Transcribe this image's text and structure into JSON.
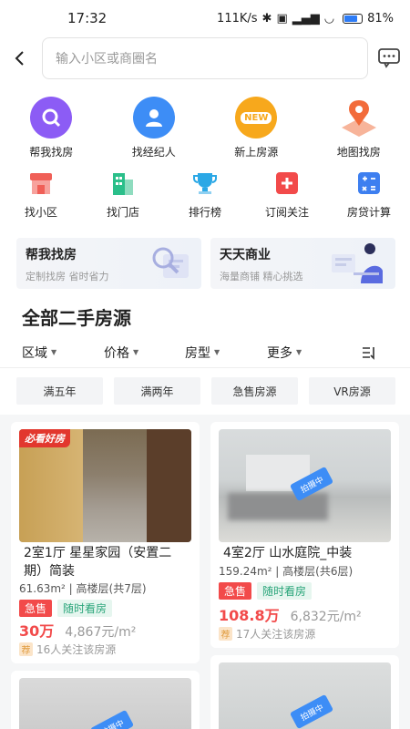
{
  "status_bar": {
    "time": "17:32",
    "speed": "111K/s",
    "battery": "81%"
  },
  "search": {
    "placeholder": "输入小区或商圈名"
  },
  "primary_nav": [
    {
      "label": "帮我找房",
      "icon": "magnifier-icon",
      "color": "#8c5cf5"
    },
    {
      "label": "找经纪人",
      "icon": "agent-icon",
      "color": "#3d8df6"
    },
    {
      "label": "新上房源",
      "icon": "new-badge-icon",
      "color": "#f7a81c",
      "badge": "NEW"
    },
    {
      "label": "地图找房",
      "icon": "map-pin-icon",
      "color": "#f26b3a"
    }
  ],
  "secondary_nav": [
    {
      "label": "找小区",
      "icon": "shop-icon",
      "color": "#f05f57"
    },
    {
      "label": "找门店",
      "icon": "building-icon",
      "color": "#2bbf8a"
    },
    {
      "label": "排行榜",
      "icon": "trophy-icon",
      "color": "#2ba8e6"
    },
    {
      "label": "订阅关注",
      "icon": "plus-box-icon",
      "color": "#f24a4a"
    },
    {
      "label": "房贷计算",
      "icon": "calculator-icon",
      "color": "#3d7ff0"
    }
  ],
  "banners": [
    {
      "title": "帮我找房",
      "subtitle": "定制找房 省时省力"
    },
    {
      "title": "天天商业",
      "subtitle": "海量商铺 精心挑选"
    }
  ],
  "section_title": "全部二手房源",
  "filters": [
    "区域",
    "价格",
    "房型",
    "更多"
  ],
  "quick_tags": [
    "满五年",
    "满两年",
    "急售房源",
    "VR房源"
  ],
  "listings": [
    {
      "badge_overlay": "必看好房",
      "title": "2室1厅  星星家园（安置二期）简装",
      "meta": "61.63m² | 高楼层(共7层)",
      "tags": [
        {
          "text": "急售",
          "style": "red"
        },
        {
          "text": "随时看房",
          "style": "green"
        }
      ],
      "price": "30万",
      "unit_price": "4,867元/m²",
      "follow_icon": "荐",
      "follow_text": "16人关注该房源"
    },
    {
      "stamp": "拍摄中",
      "title": "4室2厅  山水庭院_中装",
      "meta": "159.24m² | 高楼层(共6层)",
      "tags": [
        {
          "text": "急售",
          "style": "red"
        },
        {
          "text": "随时看房",
          "style": "green"
        }
      ],
      "price": "108.8万",
      "unit_price": "6,832元/m²",
      "follow_icon": "荐",
      "follow_text": "17人关注该房源"
    },
    {
      "stamp": "拍摄中"
    },
    {
      "stamp": "拍摄中"
    }
  ]
}
